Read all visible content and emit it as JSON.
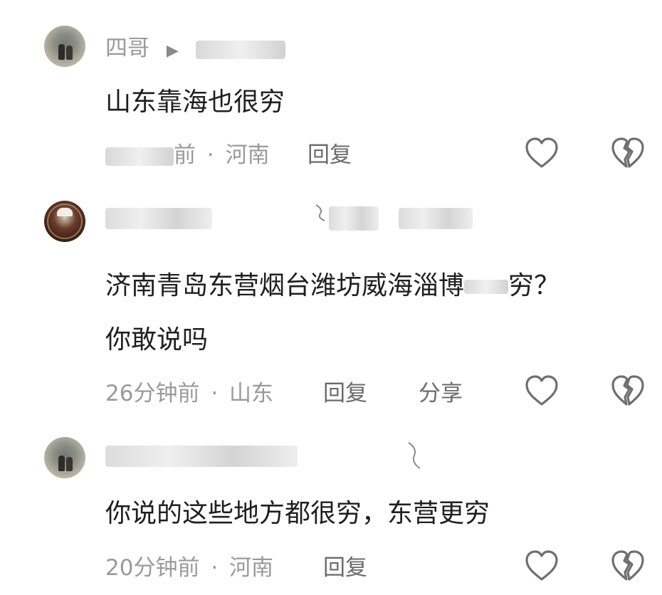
{
  "comments": [
    {
      "username": "四哥",
      "reply_arrow": "▶",
      "text": "山东靠海也很穷",
      "time_suffix": "前",
      "location": "河南",
      "reply_label": "回复"
    },
    {
      "line1_text": "济南青岛东营烟台潍坊威海淄博",
      "line1_tail": "穷？",
      "line2": "你敢说吗",
      "time": "26分钟前",
      "location": "山东",
      "reply_label": "回复",
      "share_label": "分享"
    },
    {
      "text": "你说的这些地方都很穷，东营更穷",
      "time": "20分钟前",
      "location": "河南",
      "reply_label": "回复"
    }
  ],
  "separator": "·",
  "icons": {
    "like": "heart-outline-icon",
    "dislike": "broken-heart-icon",
    "stroke_color": "#6f6f6f"
  }
}
